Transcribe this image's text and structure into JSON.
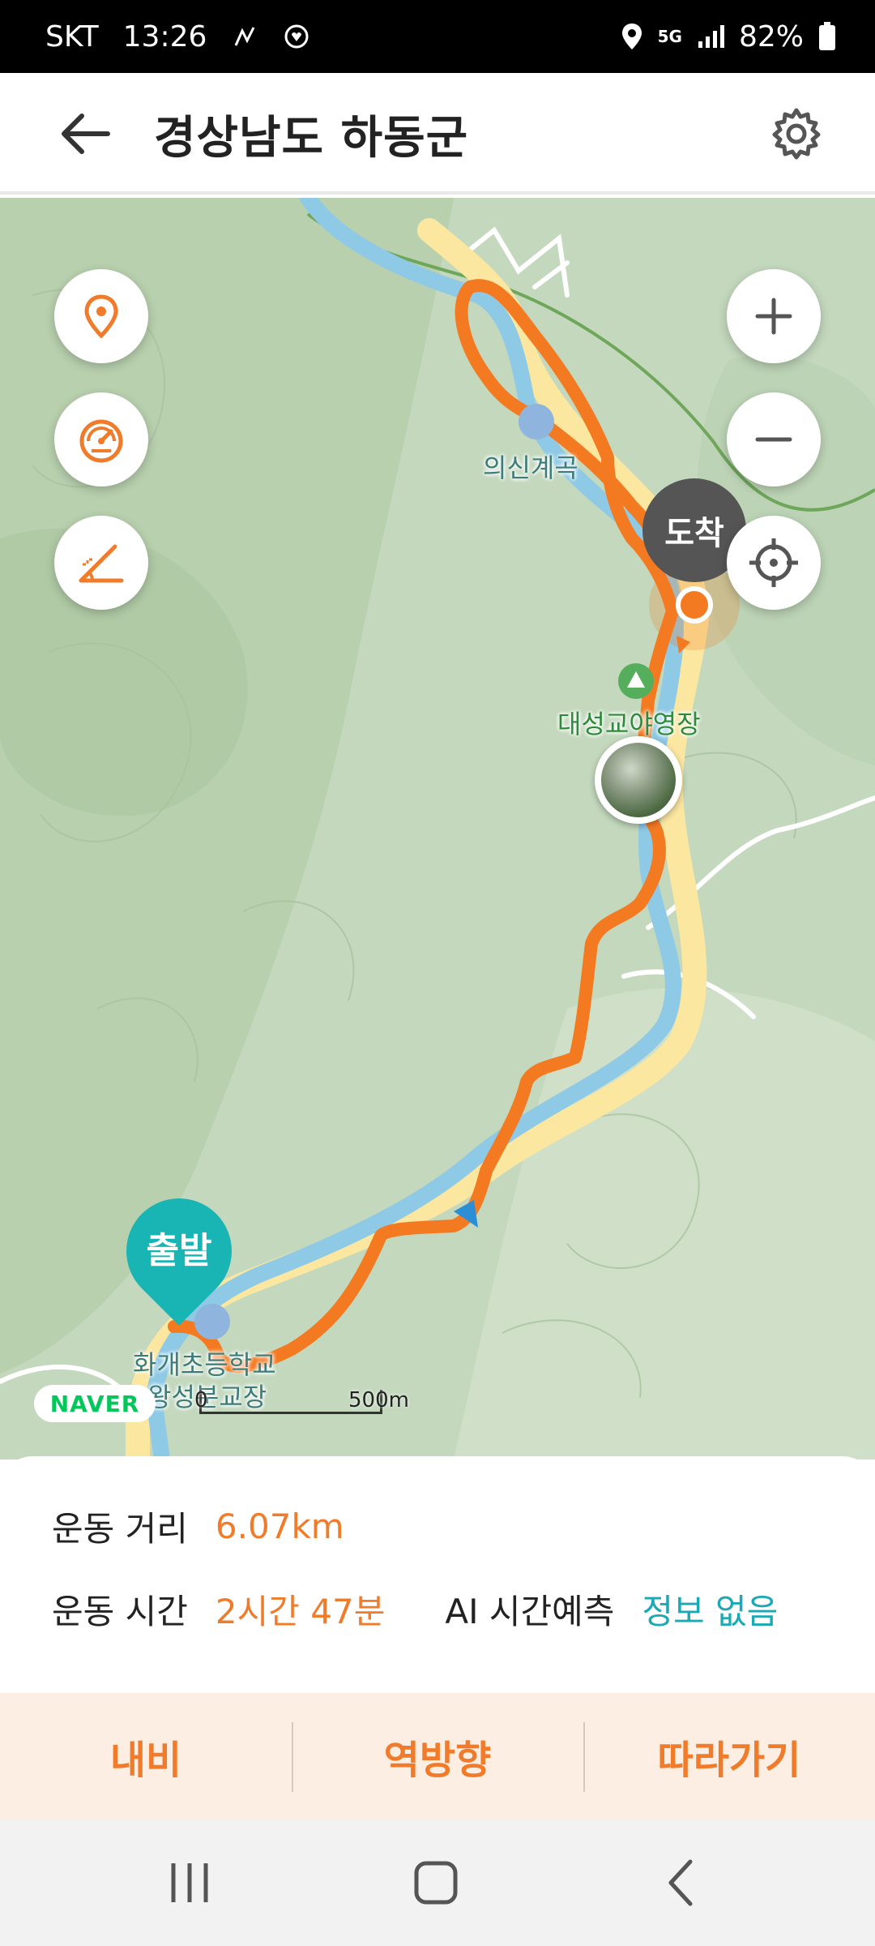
{
  "status_bar": {
    "carrier": "SKT",
    "time": "13:26",
    "network": "5G",
    "battery": "82%"
  },
  "header": {
    "title": "경상남도 하동군",
    "back_icon": "arrow-left-icon",
    "settings_icon": "gear-icon"
  },
  "map": {
    "labels": {
      "valley": "의신계곡",
      "campsite": "대성교야영장",
      "school_line1": "화개초등학교",
      "school_line2": "왕성분교장"
    },
    "markers": {
      "arrival": "도착",
      "departure": "출발"
    },
    "logo": "NAVER",
    "scale_zero": "0",
    "scale": "500m",
    "controls": {
      "left": [
        "location-pin-icon",
        "speedometer-icon",
        "elevation-profile-icon"
      ],
      "right": [
        "zoom-in-icon",
        "zoom-out-icon",
        "crosshair-icon"
      ]
    },
    "colors": {
      "route": "#f47a22",
      "river": "#8ec9e6",
      "road": "#fbe9a3",
      "terrain": "#bfd6b8"
    }
  },
  "info": {
    "distance_label": "운동 거리",
    "distance_value": "6.07km",
    "time_label": "운동 시간",
    "time_value": "2시간 47분",
    "ai_label": "AI 시간예측",
    "ai_value": "정보 없음"
  },
  "actions": {
    "navi": "내비",
    "reverse": "역방향",
    "follow": "따라가기"
  },
  "nav": [
    "recent-apps-icon",
    "home-icon",
    "back-icon"
  ]
}
